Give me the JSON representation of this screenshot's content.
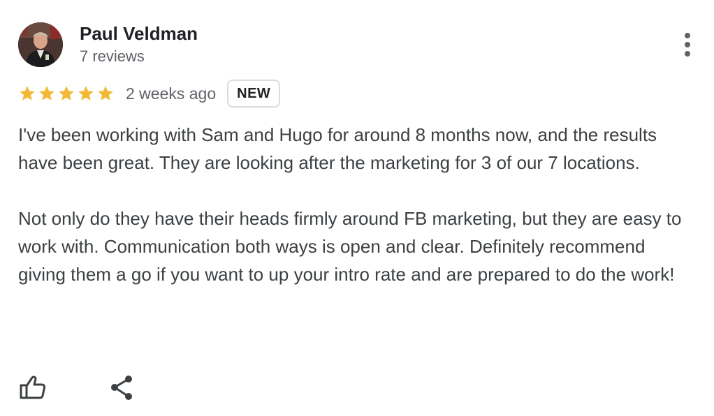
{
  "reviewer": {
    "name": "Paul Veldman",
    "reviews_count": "7 reviews",
    "avatar": "reviewer-photo"
  },
  "review": {
    "rating": 5,
    "rating_max": 5,
    "time_ago": "2 weeks ago",
    "badge": "NEW",
    "paragraphs": [
      "I've been working with Sam and Hugo for around 8 months now, and the results have been great. They are looking after the marketing for 3 of our 7 locations.",
      "Not only do they have their heads firmly around FB marketing, but they are easy to work with. Communication both ways is open and clear. Definitely recommend giving them a go if you want to up your intro rate and are prepared to do the work!"
    ]
  },
  "actions": {
    "more_icon": "more-vert-icon",
    "like_icon": "thumb-up-icon",
    "share_icon": "share-icon"
  },
  "colors": {
    "star": "#f2b936",
    "secondary_text": "#5f6368",
    "body_text": "#3c4043",
    "badge_border": "#dadce0"
  }
}
